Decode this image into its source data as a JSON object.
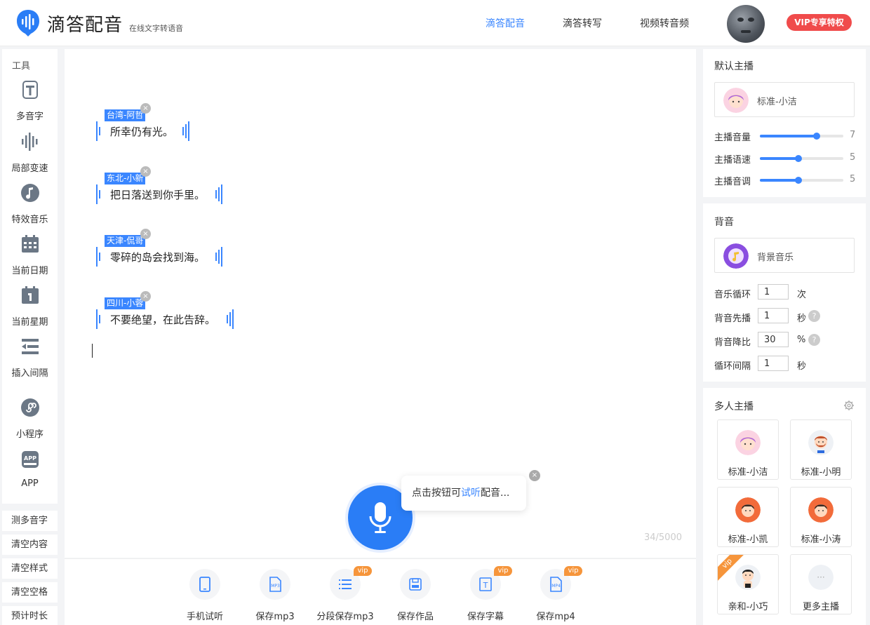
{
  "header": {
    "title": "滴答配音",
    "subtitle": "在线文字转语音",
    "nav": [
      "滴答配音",
      "滴答转写",
      "视频转音频"
    ],
    "vip_label": "VIP专享特权"
  },
  "tools": {
    "title": "工具",
    "items": [
      "多音字",
      "局部变速",
      "特效音乐",
      "当前日期",
      "当前星期",
      "插入间隔",
      "小程序",
      "APP"
    ]
  },
  "actions": [
    "测多音字",
    "清空内容",
    "清空样式",
    "清空空格",
    "预计时长"
  ],
  "editor": {
    "lines": [
      {
        "tag": "台湾-阿哲",
        "text": "所幸仍有光。"
      },
      {
        "tag": "东北-小新",
        "text": "把日落送到你手里。"
      },
      {
        "tag": "天津-侃哥",
        "text": "零碎的岛会找到海。"
      },
      {
        "tag": "四川-小蓉",
        "text": "不要绝望，在此告辞。"
      }
    ],
    "counter": "34/5000",
    "tooltip_prefix": "点击按钮可",
    "tooltip_link": "试听",
    "tooltip_suffix": "配音..."
  },
  "bottom_toolbar": [
    {
      "label": "手机试听",
      "icon": "phone-icon",
      "vip": ""
    },
    {
      "label": "保存mp3",
      "icon": "mp3-icon",
      "vip": ""
    },
    {
      "label": "分段保存mp3",
      "icon": "list-icon",
      "vip": "vip"
    },
    {
      "label": "保存作品",
      "icon": "save-icon",
      "vip": ""
    },
    {
      "label": "保存字幕",
      "icon": "subtitle-icon",
      "vip": "vip"
    },
    {
      "label": "保存mp4",
      "icon": "mp4-icon",
      "vip": "vip"
    }
  ],
  "icon_text": {
    "mp3": "MP3",
    "mp4": "MP4",
    "subtitle": "T",
    "app": "APP",
    "more": "···"
  },
  "default_speaker": {
    "title": "默认主播",
    "name": "标准-小洁",
    "sliders": [
      {
        "label": "主播音量",
        "value": "7",
        "fraction": 0.68
      },
      {
        "label": "主播语速",
        "value": "5",
        "fraction": 0.46
      },
      {
        "label": "主播音调",
        "value": "5",
        "fraction": 0.46
      }
    ]
  },
  "background_music": {
    "title": "背音",
    "name": "背景音乐",
    "rows": [
      {
        "label": "音乐循环",
        "value": "1",
        "unit": "次",
        "help": ""
      },
      {
        "label": "背音先播",
        "value": "1",
        "unit": "秒",
        "help": "?"
      },
      {
        "label": "背音降比",
        "value": "30",
        "unit": "%",
        "help": "?"
      },
      {
        "label": "循环间隔",
        "value": "1",
        "unit": "秒",
        "help": ""
      }
    ]
  },
  "multi_speakers": {
    "title": "多人主播",
    "items": [
      {
        "name": "标准-小洁",
        "avatar": "girl",
        "vip": ""
      },
      {
        "name": "标准-小明",
        "avatar": "boy-beard",
        "vip": ""
      },
      {
        "name": "标准-小凯",
        "avatar": "boy",
        "vip": ""
      },
      {
        "name": "标准-小涛",
        "avatar": "boy",
        "vip": ""
      },
      {
        "name": "亲和-小巧",
        "avatar": "kid",
        "vip": "vip"
      },
      {
        "name": "更多主播",
        "avatar": "more",
        "vip": ""
      }
    ]
  },
  "colors": {
    "accent": "#3a86ff",
    "vip_red": "#f04b4b",
    "vip_orange": "#f6953b"
  }
}
